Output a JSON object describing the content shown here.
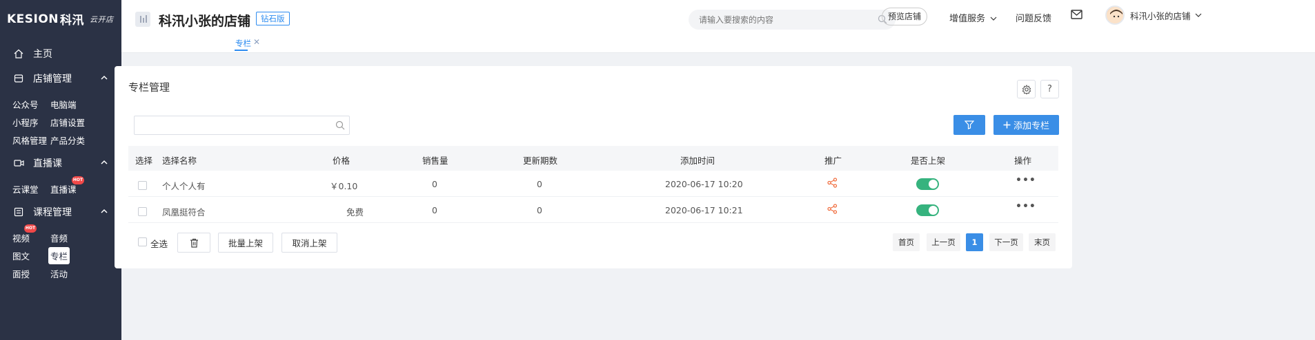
{
  "brand": {
    "logo_text": "KESION",
    "logo_cn": "科汛",
    "logo_sub": "云开店"
  },
  "sidebar": {
    "home": "主页",
    "store_mgmt": "店铺管理",
    "store_items": [
      "公众号",
      "电脑端",
      "小程序",
      "店铺设置",
      "风格管理",
      "产品分类"
    ],
    "live": "直播课",
    "live_items": [
      "云课堂",
      "直播课"
    ],
    "course_mgmt": "课程管理",
    "course_items": [
      "视频",
      "音频",
      "图文",
      "专栏",
      "面授",
      "活动"
    ],
    "hot_label": "HOT"
  },
  "header": {
    "store_title": "科汛小张的店铺",
    "edition_badge": "钻石版",
    "search_placeholder": "请输入要搜索的内容",
    "preview_btn": "预览店铺",
    "value_added": "增值服务",
    "feedback": "问题反馈",
    "user_name": "科汛小张的店铺"
  },
  "tabs": {
    "active_tab": "专栏"
  },
  "card": {
    "title": "专栏管理",
    "help": "?",
    "add_btn": "添加专栏",
    "columns": [
      "选择",
      "选择名称",
      "价格",
      "销售量",
      "更新期数",
      "添加时间",
      "推广",
      "是否上架",
      "操作"
    ],
    "rows": [
      {
        "name": "个人个人有",
        "price": "￥0.10",
        "sales": "0",
        "issues": "0",
        "added": "2020-06-17 10:20",
        "on_shelf": true
      },
      {
        "name": "凤凰挺符合",
        "price": "免费",
        "sales": "0",
        "issues": "0",
        "added": "2020-06-17 10:21",
        "on_shelf": true
      }
    ],
    "select_all": "全选",
    "batch_on": "批量上架",
    "cancel_on": "取消上架",
    "pagination": {
      "first": "首页",
      "prev": "上一页",
      "current": "1",
      "next": "下一页",
      "last": "末页"
    }
  },
  "colors": {
    "sidebar_bg": "#2b3245",
    "accent": "#3a8ee6",
    "toggle_on": "#36b37e",
    "share": "#f06a3a"
  }
}
